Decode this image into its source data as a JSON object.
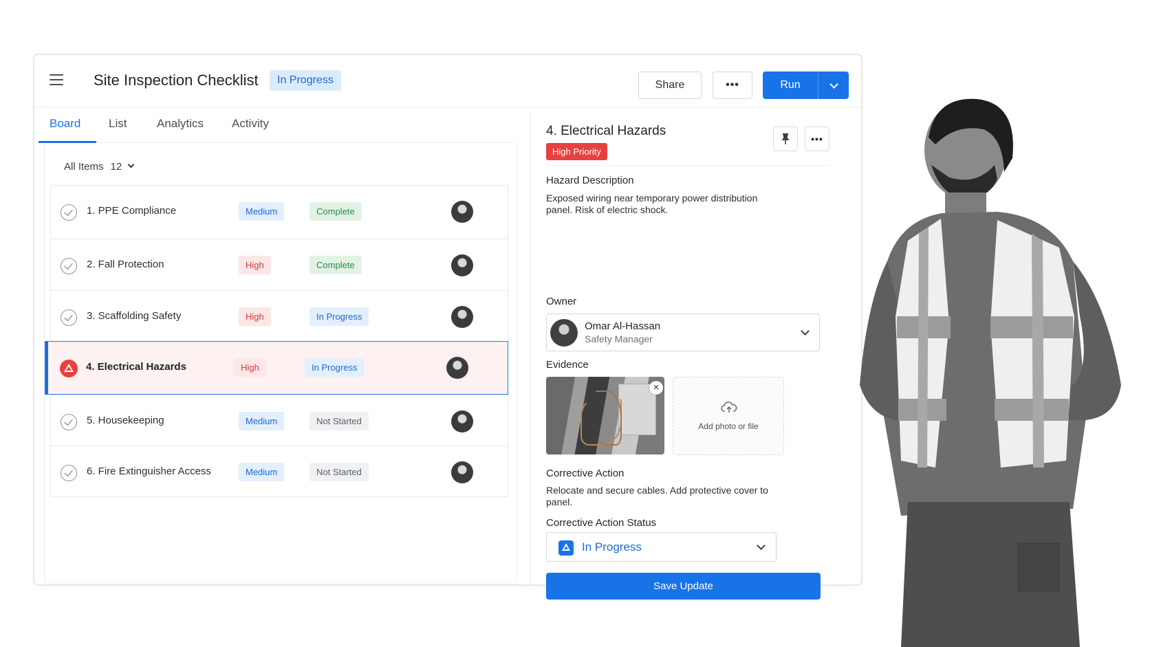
{
  "header": {
    "title": "Site Inspection Checklist",
    "status_badge": "In Progress",
    "share_label": "Share",
    "more_label": "•••",
    "run_label": "Run"
  },
  "tabs": [
    {
      "label": "Board",
      "active": true
    },
    {
      "label": "List",
      "active": false
    },
    {
      "label": "Analytics",
      "active": false
    },
    {
      "label": "Activity",
      "active": false
    }
  ],
  "filter": {
    "label": "All Items",
    "count": "12"
  },
  "items": [
    {
      "name": "1. PPE Compliance",
      "priority": "Medium",
      "status": "Complete",
      "selected": false
    },
    {
      "name": "2. Fall Protection",
      "priority": "High",
      "status": "Complete",
      "selected": false
    },
    {
      "name": "3. Scaffolding Safety",
      "priority": "High",
      "status": "In Progress",
      "selected": false
    },
    {
      "name": "4. Electrical Hazards",
      "priority": "High",
      "status": "In Progress",
      "selected": true
    },
    {
      "name": "5. Housekeeping",
      "priority": "Medium",
      "status": "Not Started",
      "selected": false
    },
    {
      "name": "6. Fire Extinguisher Access",
      "priority": "Medium",
      "status": "Not Started",
      "selected": false
    }
  ],
  "detail": {
    "title": "4. Electrical Hazards",
    "priority_badge": "High Priority",
    "hazard_label": "Hazard Description",
    "hazard_text": "Exposed wiring near temporary power distribution panel. Risk of electric shock.",
    "owner_label": "Owner",
    "owner_name": "Omar Al-Hassan",
    "owner_role": "Safety Manager",
    "evidence_label": "Evidence",
    "upload_label": "Add photo or file",
    "corrective_label": "Corrective Action",
    "corrective_text": "Relocate and secure cables. Add protective cover to panel.",
    "status_label": "Corrective Action Status",
    "status_value": "In Progress",
    "save_label": "Save Update"
  },
  "colors": {
    "accent": "#1873e8",
    "danger": "#e8403f",
    "success_bg": "#e2f3e6",
    "info_bg": "#e3effc"
  }
}
